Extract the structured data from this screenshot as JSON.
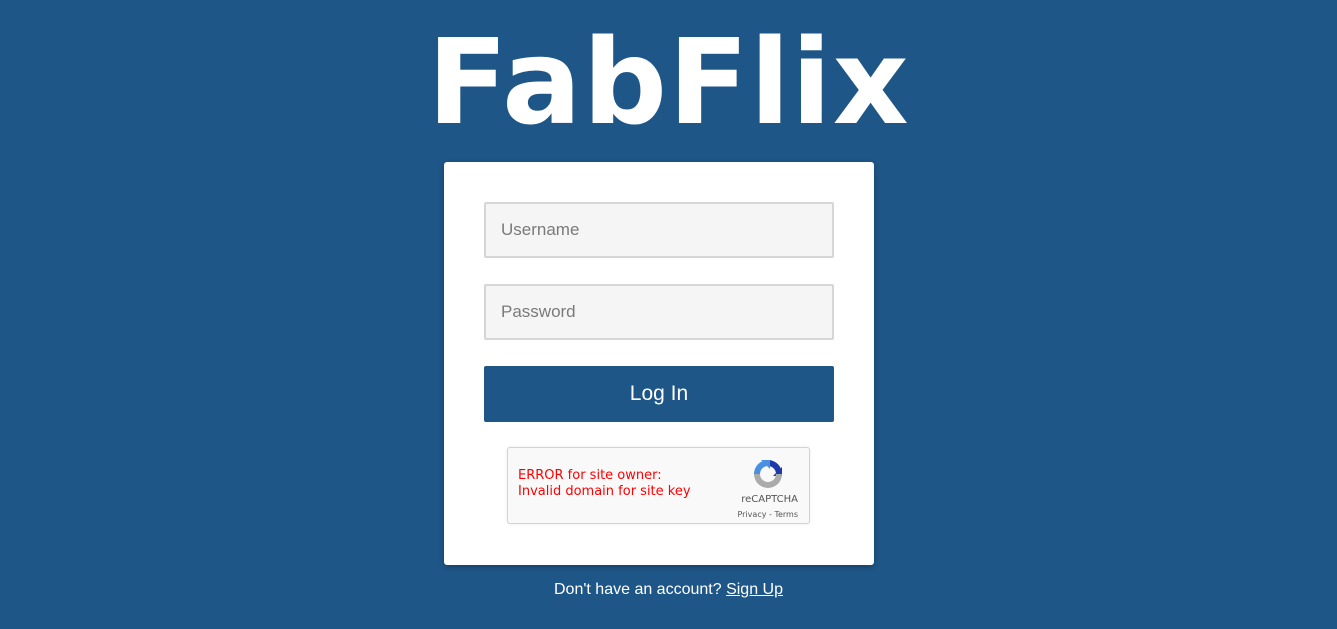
{
  "brand": {
    "title": "FabFlix",
    "background_color": "#1e5687",
    "accent_color": "#1e5687"
  },
  "login_form": {
    "username_placeholder": "Username",
    "username_value": "",
    "password_placeholder": "Password",
    "password_value": "",
    "submit_label": "Log In"
  },
  "recaptcha": {
    "error_line1": "ERROR for site owner:",
    "error_line2": "Invalid domain for site key",
    "brand": "reCAPTCHA",
    "privacy_label": "Privacy",
    "separator": " - ",
    "terms_label": "Terms",
    "logo_icon": "recaptcha-logo-icon",
    "error_color": "#ff0000"
  },
  "signup": {
    "prompt": "Don't have an account?",
    "link_label": "Sign Up"
  }
}
